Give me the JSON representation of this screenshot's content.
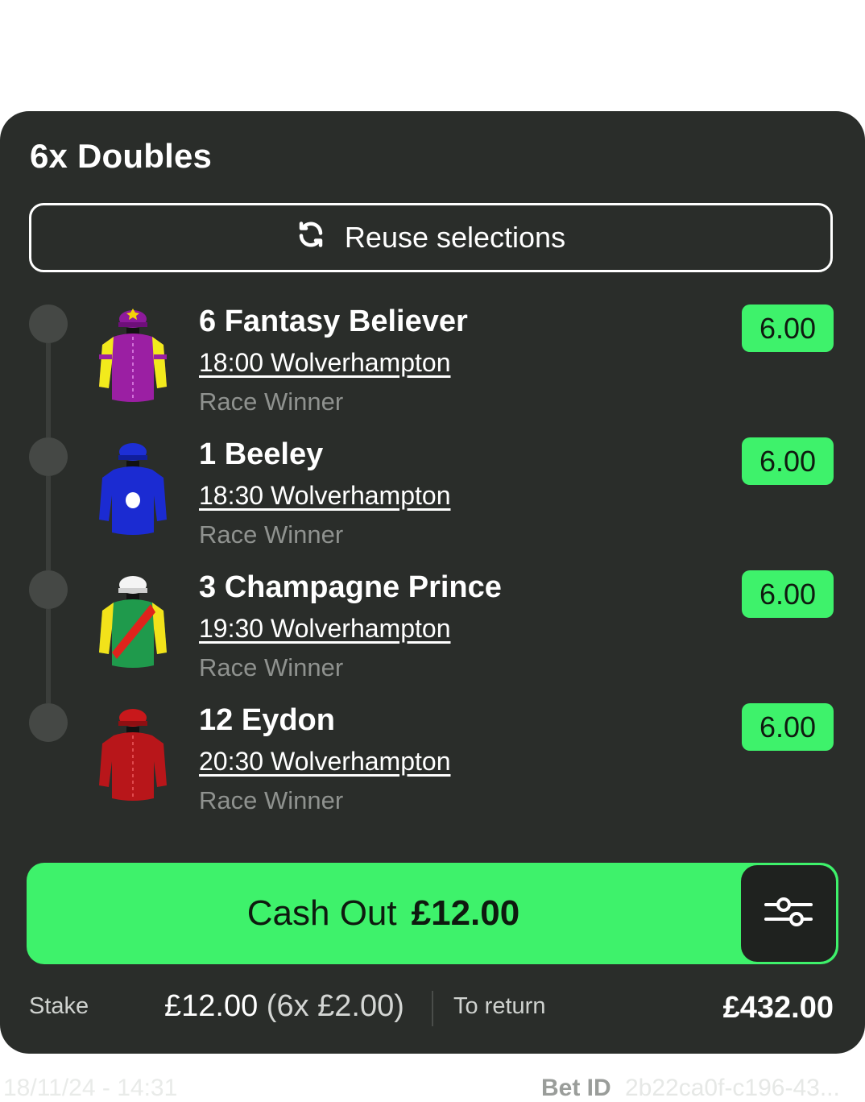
{
  "bet": {
    "title": "6x Doubles",
    "reuse_label": "Reuse selections",
    "legs": [
      {
        "number": "6",
        "name": "Fantasy Believer",
        "race": "18:00 Wolverhampton",
        "market": "Race Winner",
        "odds": "6.00",
        "silk": "purple-yellow-silk"
      },
      {
        "number": "1",
        "name": "Beeley",
        "race": "18:30 Wolverhampton",
        "market": "Race Winner",
        "odds": "6.00",
        "silk": "blue-white-spot-silk"
      },
      {
        "number": "3",
        "name": "Champagne Prince",
        "race": "19:30 Wolverhampton",
        "market": "Race Winner",
        "odds": "6.00",
        "silk": "green-red-sash-silk"
      },
      {
        "number": "12",
        "name": "Eydon",
        "race": "20:30 Wolverhampton",
        "market": "Race Winner",
        "odds": "6.00",
        "silk": "red-silk"
      }
    ],
    "cashout": {
      "label": "Cash Out",
      "amount": "£12.00"
    },
    "stake_label": "Stake",
    "stake_value": "£12.00",
    "stake_breakdown": "(6x £2.00)",
    "return_label": "To return",
    "return_value": "£432.00",
    "placed_at": "18/11/24 - 14:31",
    "bet_id_label": "Bet ID",
    "bet_id": "2b22ca0f-c196-43..."
  },
  "colors": {
    "accent": "#3ef26b",
    "card": "#2a2d2a",
    "muted": "#8f928f"
  },
  "icons": {
    "reuse": "refresh-icon",
    "settings": "sliders-icon"
  }
}
